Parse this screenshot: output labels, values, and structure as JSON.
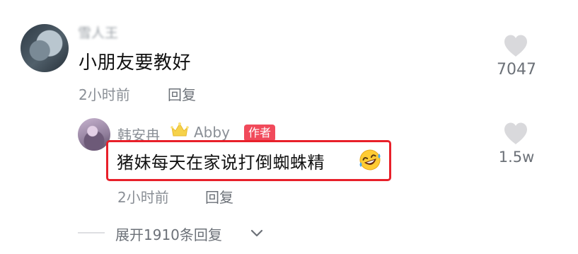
{
  "comment": {
    "username": "雪人王",
    "text": "小朋友要教好",
    "time": "2小时前",
    "reply_label": "回复",
    "like_count": "7047"
  },
  "reply": {
    "username": "韩安冉",
    "nickname": "Abby",
    "badge": "作者",
    "text": "猪妹每天在家说打倒蜘蛛精",
    "time": "2小时前",
    "reply_label": "回复",
    "like_count": "1.5w"
  },
  "expand": {
    "label": "展开1910条回复"
  },
  "colors": {
    "highlight": "#e8202a",
    "badge": "#f14a5b",
    "heart": "#d9d9dc"
  }
}
